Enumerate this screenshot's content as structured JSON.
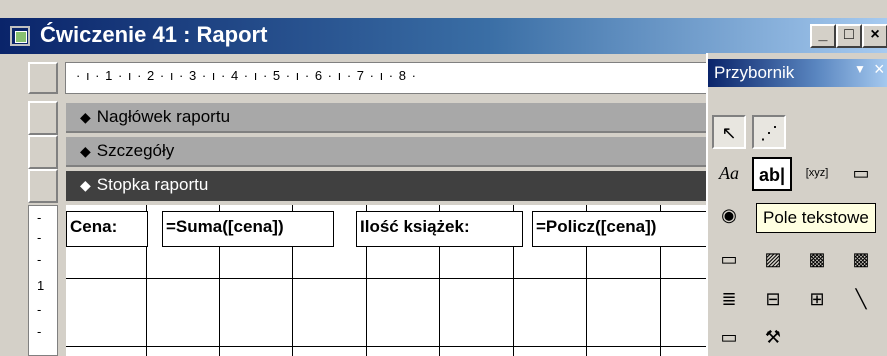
{
  "window": {
    "title": "Ćwiczenie 41 : Raport",
    "minimize_label": "_",
    "maximize_label": "□",
    "close_label": "×"
  },
  "ruler": {
    "text": "· ı · 1 · ı · 2 · ı · 3 · ı · 4 · ı · 5 · ı · 6 · ı · 7 · ı · 8 ·"
  },
  "sections": [
    {
      "label": "Nagłówek raportu"
    },
    {
      "label": "Szczegóły"
    },
    {
      "label": "Stopka raportu"
    }
  ],
  "vertical_ruler": [
    "-",
    "-",
    "-",
    "1",
    "-",
    "-"
  ],
  "footer_controls": [
    {
      "text": "Cena:"
    },
    {
      "text": "=Suma([cena])"
    },
    {
      "text": "Ilość książek:"
    },
    {
      "text": "=Policz([cena])"
    }
  ],
  "toolbox": {
    "title": "Przybornik",
    "menu_glyph": "▼",
    "close_glyph": "×",
    "tools": [
      {
        "icon": "pointer-icon",
        "glyph": "↖"
      },
      {
        "icon": "control-wizard-icon",
        "glyph": "⋰"
      },
      {
        "icon": "label-icon",
        "glyph": "Aa"
      },
      {
        "icon": "text-box-icon",
        "glyph": "ab|"
      },
      {
        "icon": "option-group-icon",
        "glyph": "[xyz]"
      },
      {
        "icon": "toggle-button-icon",
        "glyph": "▭"
      },
      {
        "icon": "option-button-icon",
        "glyph": "◉"
      },
      {
        "icon": "combo-box-icon",
        "glyph": "▭"
      },
      {
        "icon": "image-icon",
        "glyph": "▨"
      },
      {
        "icon": "unbound-object-icon",
        "glyph": "▩"
      },
      {
        "icon": "bound-object-icon",
        "glyph": "▩"
      },
      {
        "icon": "page-break-icon",
        "glyph": "≣"
      },
      {
        "icon": "tab-control-icon",
        "glyph": "⊟"
      },
      {
        "icon": "subreport-icon",
        "glyph": "⊞"
      },
      {
        "icon": "line-icon",
        "glyph": "╲"
      },
      {
        "icon": "rectangle-icon",
        "glyph": "▭"
      },
      {
        "icon": "more-controls-icon",
        "glyph": "⚒"
      }
    ],
    "tooltip": "Pole tekstowe"
  }
}
